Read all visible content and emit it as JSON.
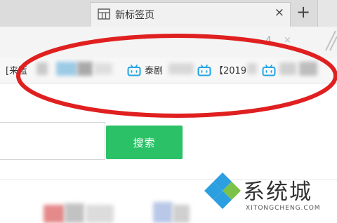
{
  "tab": {
    "title": "新标签页",
    "close_glyph": "×",
    "icon": "grid-icon"
  },
  "new_tab_glyph": "+",
  "toolbar": {
    "digit": "4",
    "x_glyph": "×"
  },
  "bookmarks": [
    {
      "label": "[来蓝",
      "icon": "none"
    },
    {
      "label": "泰剧",
      "icon": "bilibili-tv-icon"
    },
    {
      "label": "【2019",
      "icon": "bilibili-tv-icon"
    },
    {
      "label": "",
      "icon": "bilibili-tv-icon"
    }
  ],
  "search": {
    "value": "",
    "button_label": "搜索"
  },
  "colors": {
    "annotation": "#e02020",
    "search_button": "#2bc167",
    "bilibili": "#23a4e6"
  },
  "watermark": {
    "title": "系统城",
    "url": "XITONGCHENG.COM"
  }
}
